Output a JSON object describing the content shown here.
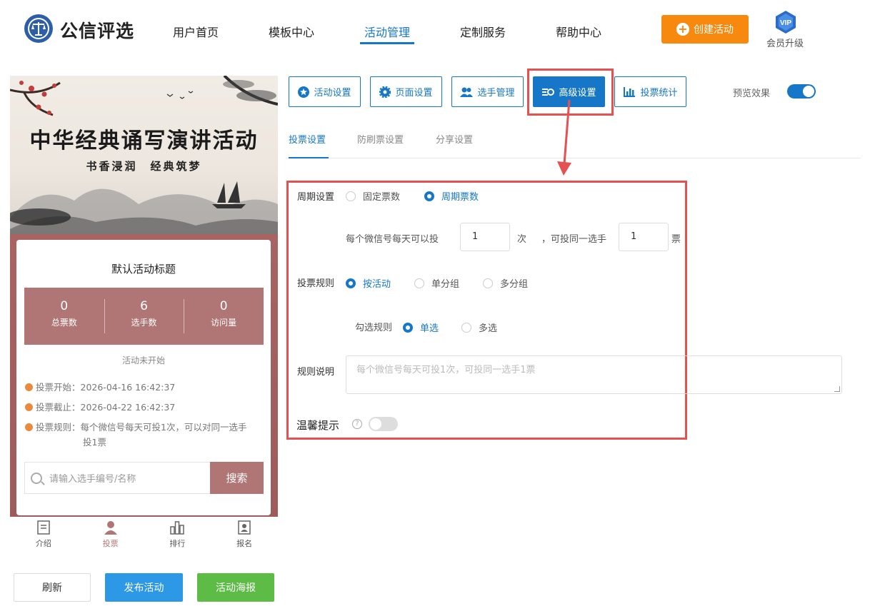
{
  "header": {
    "brand": "公信评选",
    "nav": [
      {
        "label": "用户首页",
        "active": false
      },
      {
        "label": "模板中心",
        "active": false
      },
      {
        "label": "活动管理",
        "active": true
      },
      {
        "label": "定制服务",
        "active": false
      },
      {
        "label": "帮助中心",
        "active": false
      }
    ],
    "create_label": "创建活动",
    "vip_badge": "VIP",
    "vip_label": "会员升级"
  },
  "preview": {
    "banner_title": "中华经典诵写演讲活动",
    "banner_sub": "书香浸润　经典筑梦",
    "card_title": "默认活动标题",
    "stats": [
      {
        "value": "0",
        "label": "总票数"
      },
      {
        "value": "6",
        "label": "选手数"
      },
      {
        "value": "0",
        "label": "访问量"
      }
    ],
    "status": "活动未开始",
    "vote_start": "投票开始：2026-04-16 16:42:37",
    "vote_end": "投票截止：2026-04-22 16:42:37",
    "vote_rule_line1": "投票规则：每个微信号每天可投1次，可以对同一选手",
    "vote_rule_line2": "投1票",
    "search_placeholder": "请输入选手编号/名称",
    "search_button": "搜索",
    "tabs": [
      {
        "label": "介绍",
        "icon": "doc-icon"
      },
      {
        "label": "投票",
        "icon": "user-icon"
      },
      {
        "label": "排行",
        "icon": "rank-icon"
      },
      {
        "label": "报名",
        "icon": "badge-icon"
      }
    ]
  },
  "actions": {
    "refresh": "刷新",
    "publish": "发布活动",
    "poster": "活动海报"
  },
  "toolbar": {
    "buttons": [
      {
        "label": "活动设置",
        "icon": "star-icon"
      },
      {
        "label": "页面设置",
        "icon": "gear-icon"
      },
      {
        "label": "选手管理",
        "icon": "users-icon"
      },
      {
        "label": "高级设置",
        "icon": "sliders-icon",
        "active": true
      },
      {
        "label": "投票统计",
        "icon": "chart-icon"
      }
    ],
    "preview_label": "预览效果"
  },
  "subtabs": [
    {
      "label": "投票设置",
      "active": true
    },
    {
      "label": "防刷票设置",
      "active": false
    },
    {
      "label": "分享设置",
      "active": false
    }
  ],
  "form": {
    "cycle_label": "周期设置",
    "cycle_fixed": "固定票数",
    "cycle_periodic": "周期票数",
    "per_day_text": "每个微信号每天可以投",
    "per_day_value": "1",
    "times_unit": "次",
    "same_player_text": "，可投同一选手",
    "same_player_value": "1",
    "votes_unit": "票",
    "rule_label": "投票规则",
    "rule_by_activity": "按活动",
    "rule_single_group": "单分组",
    "rule_multi_group": "多分组",
    "check_label": "勾选规则",
    "check_single": "单选",
    "check_multi": "多选",
    "desc_label": "规则说明",
    "desc_placeholder": "每个微信号每天可投1次，可投同一选手1票",
    "tip_label": "温馨提示"
  },
  "colors": {
    "accent": "#1677c9",
    "orange": "#f7890f",
    "highlight": "#e55050",
    "card_red": "#b07575",
    "green": "#5cbc45"
  }
}
